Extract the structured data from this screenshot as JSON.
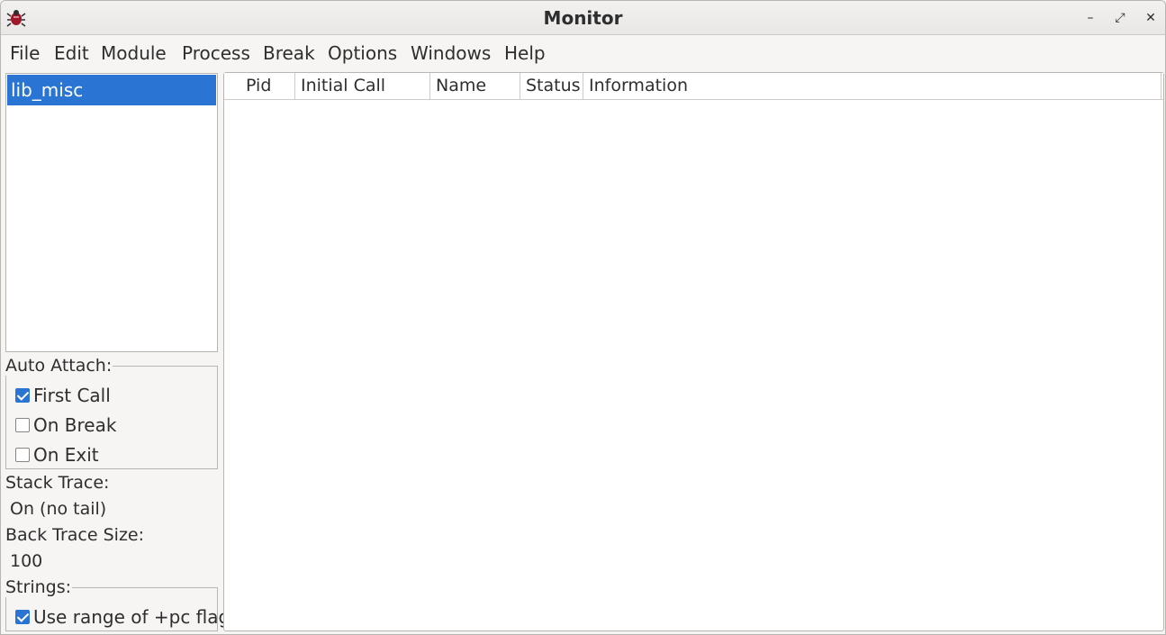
{
  "window": {
    "title": "Monitor",
    "controls": {
      "minimize": "–",
      "maximize": "⤢",
      "close": "✕"
    }
  },
  "menu": [
    "File",
    "Edit",
    "Module",
    "Process",
    "Break",
    "Options",
    "Windows",
    "Help"
  ],
  "modules": {
    "items": [
      "lib_misc"
    ],
    "selected": "lib_misc"
  },
  "auto_attach": {
    "label": "Auto Attach:",
    "options": [
      {
        "label": "First Call",
        "checked": true
      },
      {
        "label": "On Break",
        "checked": false
      },
      {
        "label": "On Exit",
        "checked": false
      }
    ]
  },
  "stack_trace": {
    "label": "Stack Trace:",
    "value": "On (no tail)"
  },
  "back_trace": {
    "label": "Back Trace Size:",
    "value": "100"
  },
  "strings": {
    "label": "Strings:",
    "options": [
      {
        "label": "Use range of +pc flag",
        "checked": true
      }
    ]
  },
  "process_table": {
    "columns": [
      "Pid",
      "Initial Call",
      "Name",
      "Status",
      "Information"
    ],
    "rows": []
  },
  "colors": {
    "selection": "#2a75d3",
    "background": "#f6f5f4"
  },
  "icons": {
    "app": "erlang-bug-icon"
  }
}
